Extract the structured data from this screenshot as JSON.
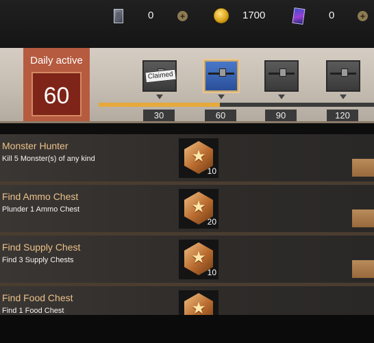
{
  "currency": {
    "cards": "0",
    "coins": "1700",
    "gems": "0",
    "plus_label": "+"
  },
  "daily": {
    "label": "Daily active",
    "value": "60",
    "progress_fraction": 0.44,
    "claimed_label": "Claimed",
    "milestones": [
      "30",
      "60",
      "90",
      "120"
    ]
  },
  "tasks": [
    {
      "title": "Monster Hunter",
      "desc": "Kill 5 Monster(s) of any kind",
      "reward": "10",
      "reward_icon": "star-medal-icon"
    },
    {
      "title": "Find Ammo Chest",
      "desc": "Plunder 1 Ammo Chest",
      "reward": "20",
      "reward_icon": "star-medal-icon"
    },
    {
      "title": "Find Supply Chest",
      "desc": "Find 3 Supply Chests",
      "reward": "10",
      "reward_icon": "star-medal-icon"
    },
    {
      "title": "Find Food Chest",
      "desc": "Find 1 Food Chest",
      "reward": "",
      "reward_icon": "star-medal-icon"
    }
  ],
  "colors": {
    "accent_orange": "#e6a93a",
    "task_title": "#ecc28b",
    "daily_box": "#b65b3f"
  }
}
